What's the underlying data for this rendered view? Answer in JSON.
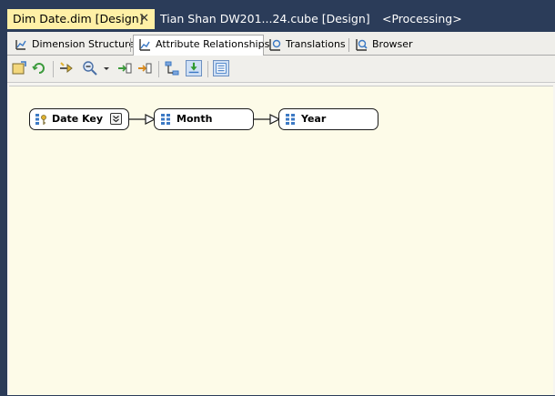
{
  "document_tabs": [
    {
      "label": "Dim Date.dim [Design]",
      "active": true,
      "close_glyph": "✕"
    },
    {
      "label": "Tian Shan DW201...24.cube [Design]",
      "active": false
    },
    {
      "label": "<Processing>",
      "active": false
    }
  ],
  "view_tabs": [
    {
      "label": "Dimension Structure",
      "icon": "dimension-structure-icon"
    },
    {
      "label": "Attribute Relationships",
      "icon": "attribute-relationships-icon",
      "selected": true
    },
    {
      "label": "Translations",
      "icon": "translations-icon"
    },
    {
      "label": "Browser",
      "icon": "browser-icon"
    }
  ],
  "toolbar": {
    "buttons": [
      "process-icon",
      "refresh-icon",
      "new-relationship-icon",
      "zoom-icon",
      "zoom-dropdown-icon",
      "expand-icon",
      "collapse-icon",
      "show-list-icon",
      "arrange-icon",
      "attribute-list-icon"
    ]
  },
  "diagram": {
    "nodes": [
      {
        "label": "Date Key",
        "type": "key-attribute"
      },
      {
        "label": "Month",
        "type": "attribute"
      },
      {
        "label": "Year",
        "type": "attribute"
      }
    ]
  },
  "colors": {
    "chrome": "#2b3c59",
    "active_tab": "#fff0a6",
    "canvas": "#fdfbe8",
    "accent": "#3c79c4"
  }
}
